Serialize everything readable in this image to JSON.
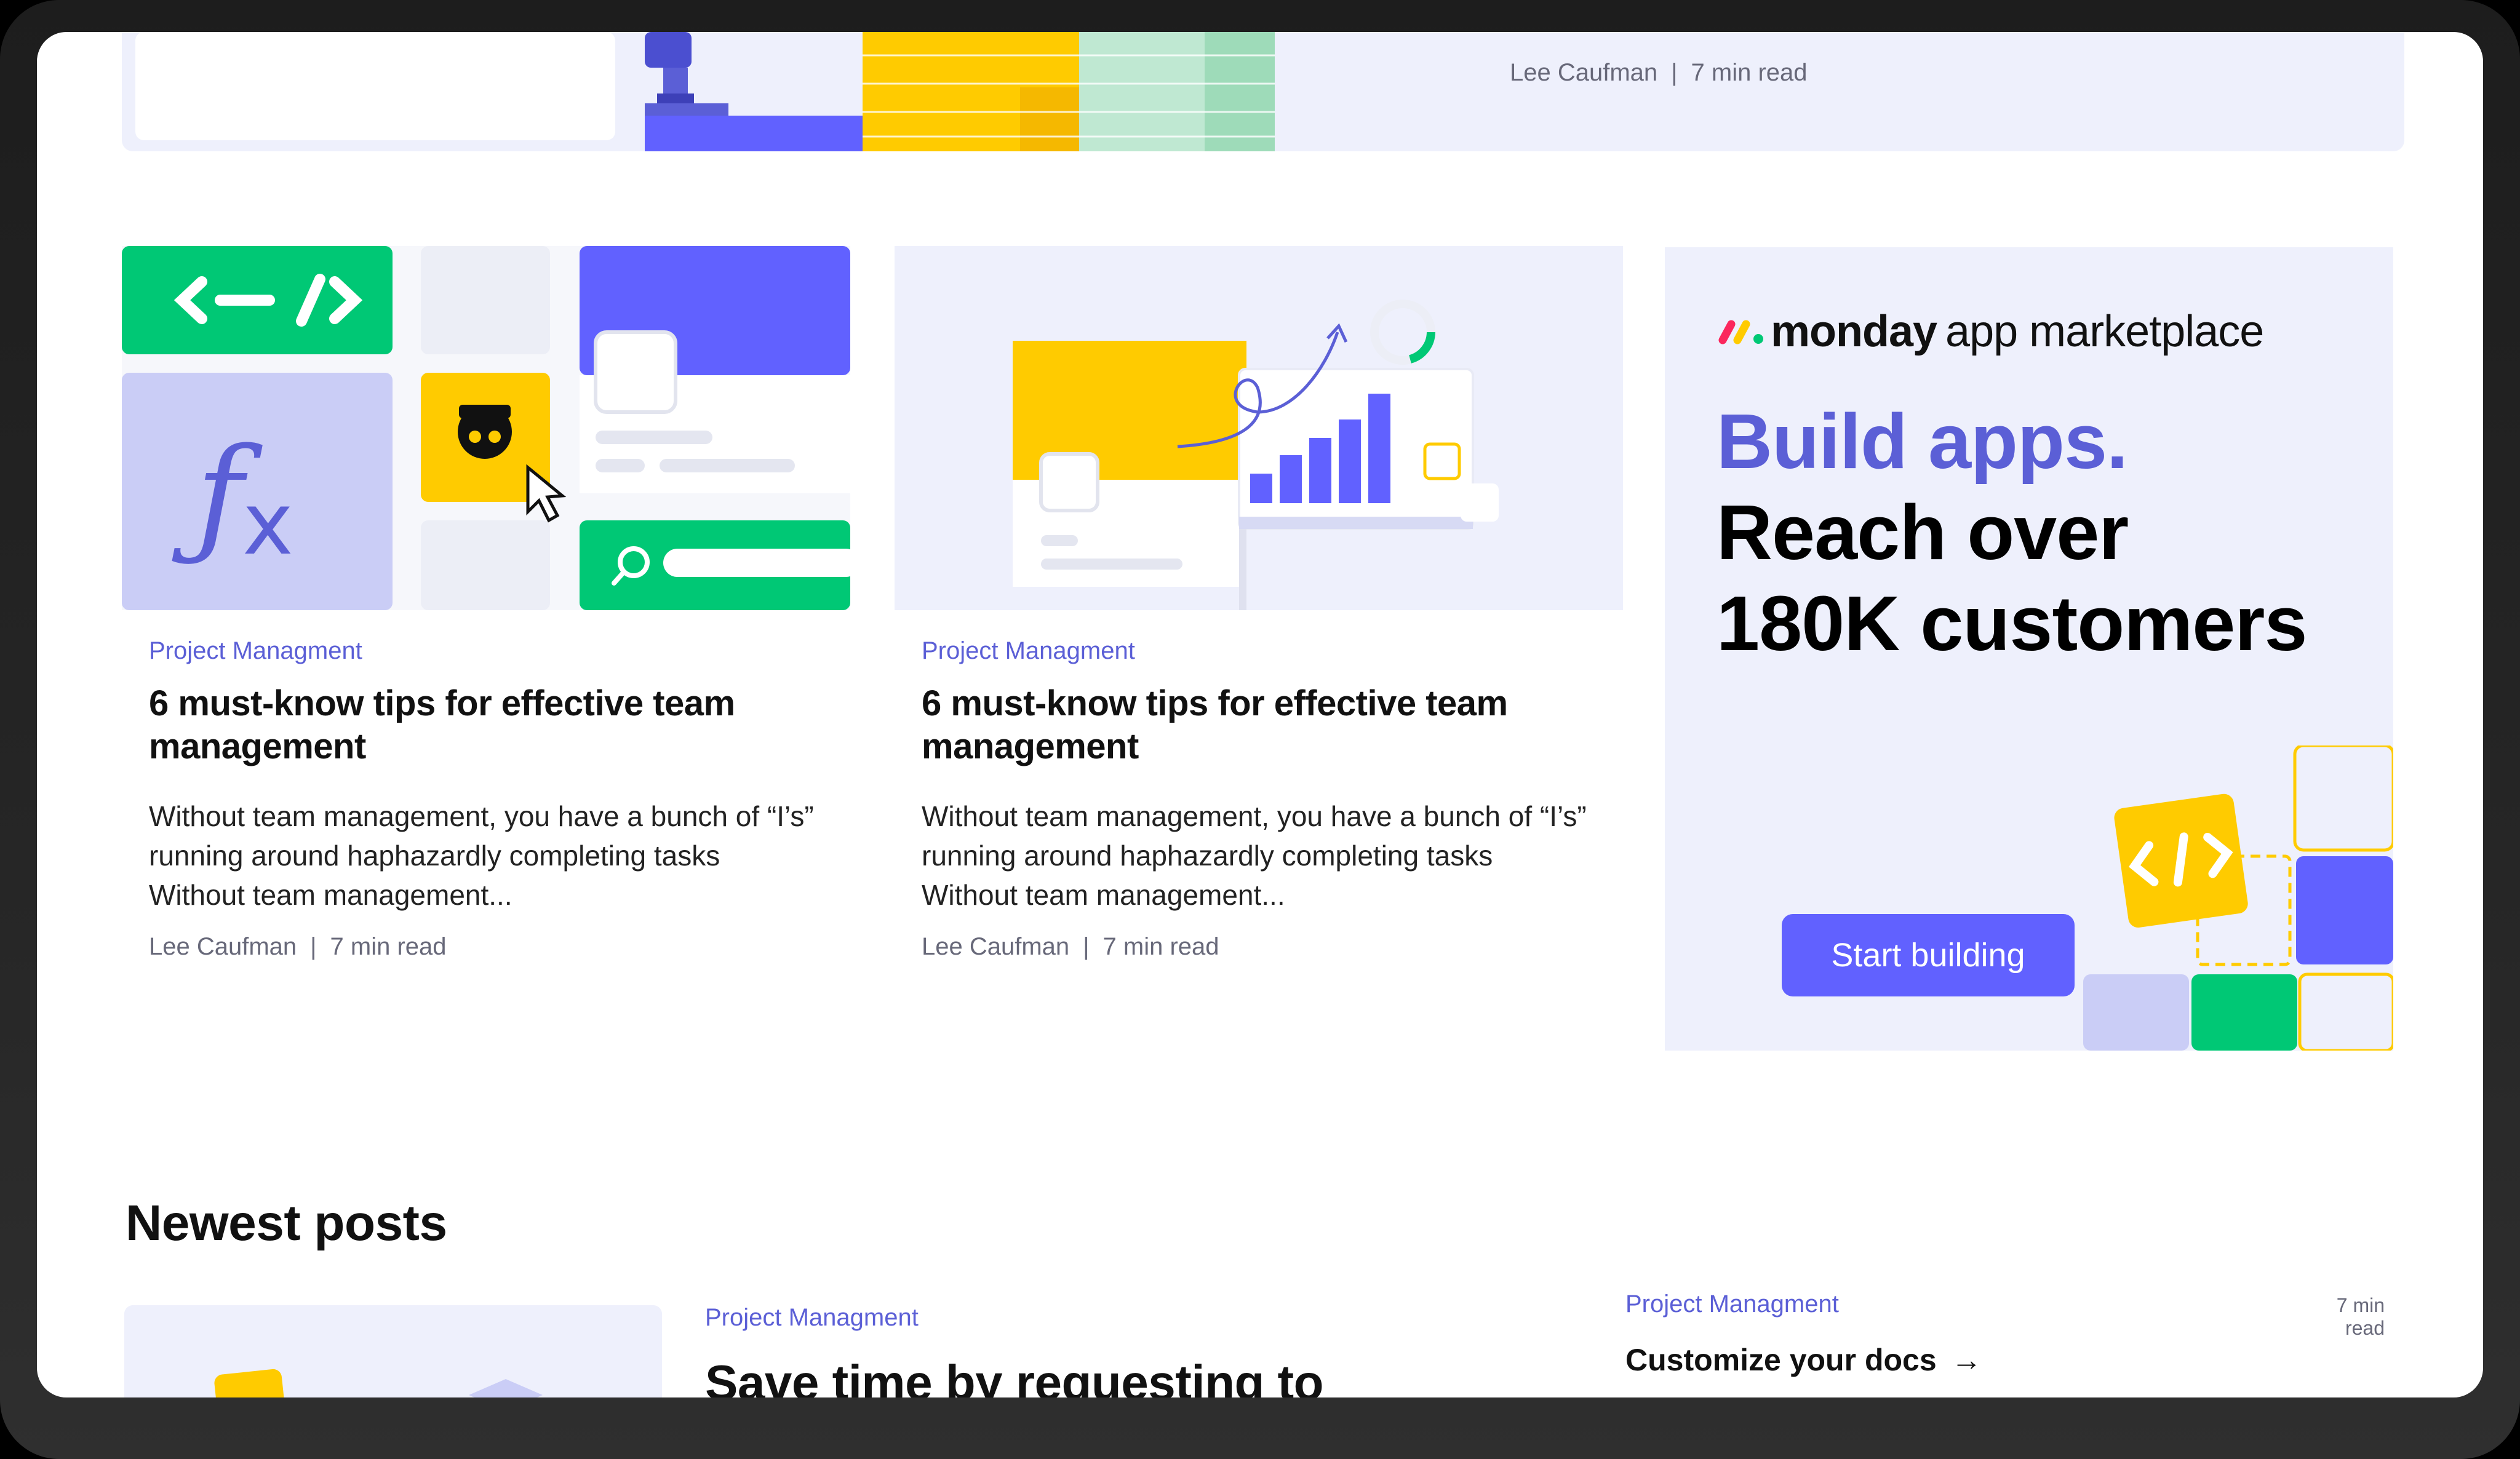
{
  "top_card": {
    "author": "Lee Caufman",
    "read_time": "7 min read"
  },
  "cards": [
    {
      "category": "Project Managment",
      "title": "6 must-know tips for effective team management",
      "description": "Without team management, you have a bunch of “I’s” running around haphazardly completing tasks Without team management...",
      "author": "Lee Caufman",
      "read_time": "7 min read"
    },
    {
      "category": "Project Managment",
      "title": "6 must-know tips for effective team management",
      "description": "Without team management, you have a bunch of “I’s” running around haphazardly completing tasks Without team management...",
      "author": "Lee Caufman",
      "read_time": "7 min read"
    }
  ],
  "ad": {
    "logo_bold": "monday",
    "logo_light": "app marketplace",
    "headline_blue": "Build apps.",
    "headline_line2": "Reach over",
    "headline_line3": "180K customers",
    "button": "Start building"
  },
  "newest": {
    "heading": "Newest posts",
    "post1": {
      "category": "Project Managment",
      "title": "Save time by requesting to"
    },
    "post2": {
      "category": "Project Managment",
      "read_time": "7 min read",
      "title": "Customize your docs",
      "arrow": "→"
    }
  },
  "colors": {
    "accent": "#6161ff",
    "category": "#5b5fd6",
    "green": "#00c875",
    "yellow": "#ffcb00",
    "lavender": "#eef0fc"
  }
}
